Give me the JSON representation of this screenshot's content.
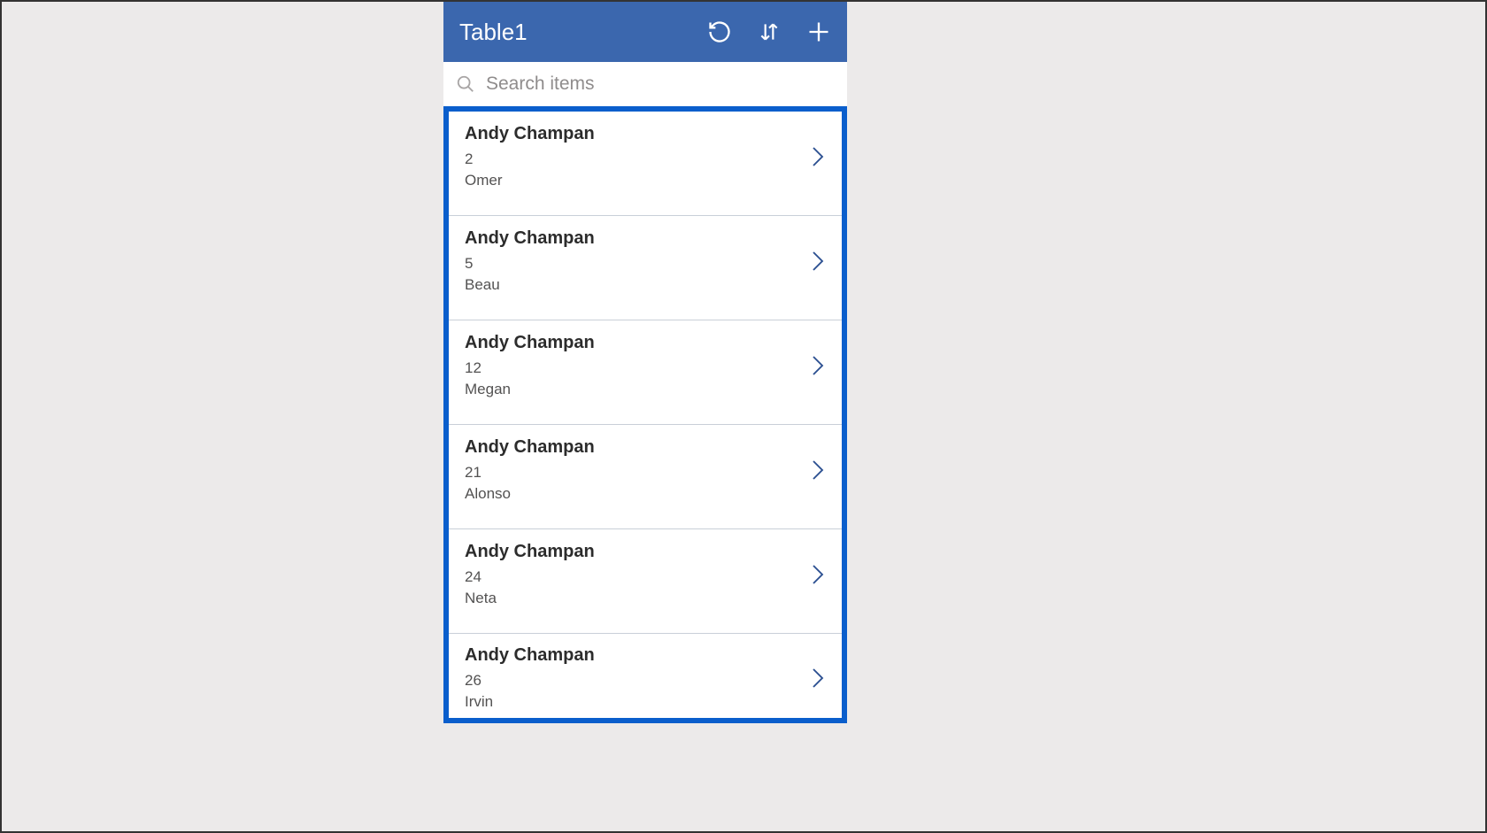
{
  "header": {
    "title": "Table1"
  },
  "search": {
    "placeholder": "Search items",
    "value": ""
  },
  "items": [
    {
      "title": "Andy Champan",
      "number": "2",
      "name": "Omer"
    },
    {
      "title": "Andy Champan",
      "number": "5",
      "name": "Beau"
    },
    {
      "title": "Andy Champan",
      "number": "12",
      "name": "Megan"
    },
    {
      "title": "Andy Champan",
      "number": "21",
      "name": "Alonso"
    },
    {
      "title": "Andy Champan",
      "number": "24",
      "name": "Neta"
    },
    {
      "title": "Andy Champan",
      "number": "26",
      "name": "Irvin"
    }
  ],
  "colors": {
    "header_bg": "#3B67AE",
    "selection_border": "#0a5ecc"
  }
}
